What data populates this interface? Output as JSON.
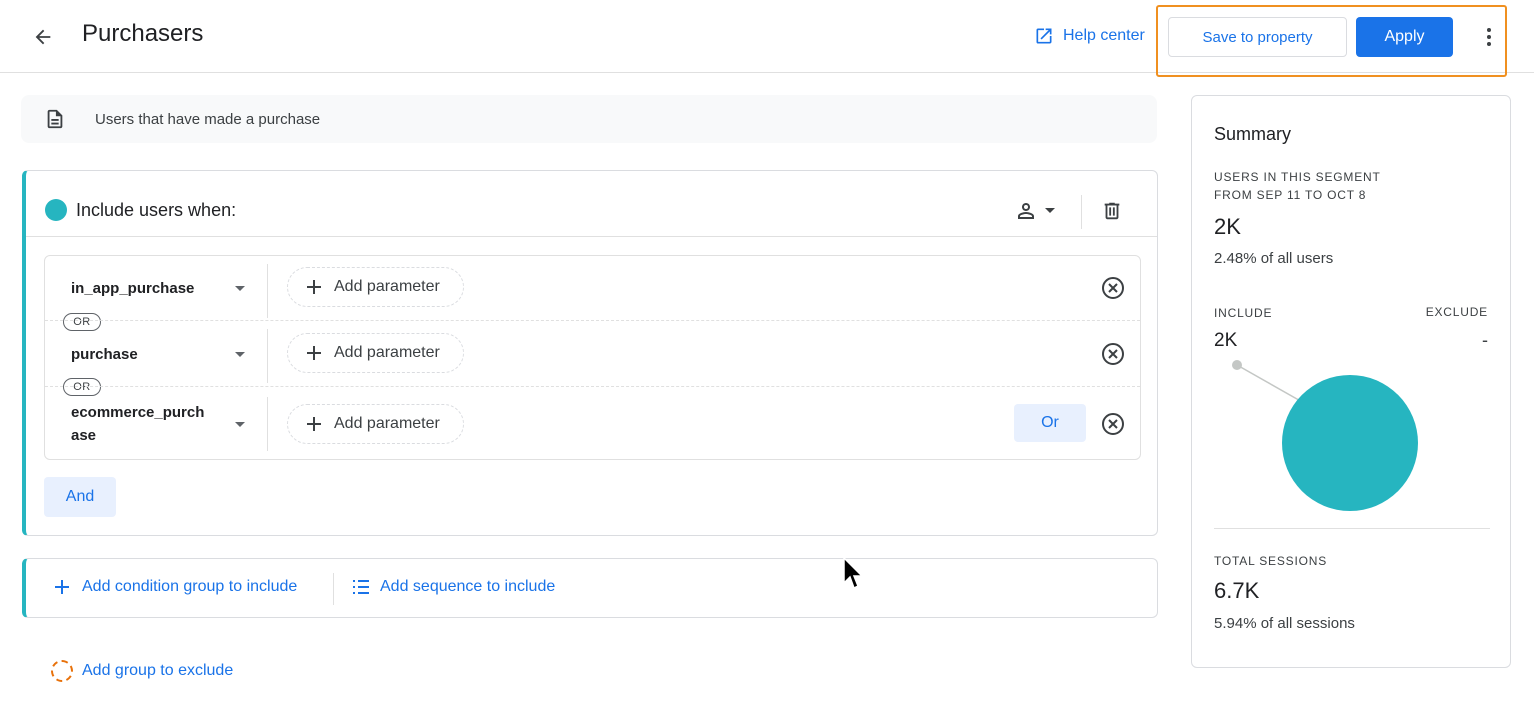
{
  "header": {
    "title": "Purchasers",
    "help_label": "Help center",
    "save_label": "Save to property",
    "apply_label": "Apply"
  },
  "description": "Users that have made a purchase",
  "include_group": {
    "title": "Include users when:",
    "conditions": [
      {
        "event": "in_app_purchase",
        "add_param_label": "Add parameter"
      },
      {
        "event": "purchase",
        "add_param_label": "Add parameter"
      },
      {
        "event": "ecommerce_purchase",
        "event_line1": "ecommerce_purch",
        "event_line2": "ase",
        "add_param_label": "Add parameter"
      }
    ],
    "or_connector": "OR",
    "or_button_label": "Or",
    "and_button_label": "And"
  },
  "add_actions": {
    "condition_group_label": "Add condition group to include",
    "sequence_label": "Add sequence to include",
    "exclude_label": "Add group to exclude"
  },
  "summary": {
    "title": "Summary",
    "segment_label_line1": "USERS IN THIS SEGMENT",
    "segment_label_line2": "FROM SEP 11 TO OCT 8",
    "users_value": "2K",
    "users_pct": "2.48% of all users",
    "include_label": "INCLUDE",
    "exclude_label": "EXCLUDE",
    "include_value": "2K",
    "exclude_value": "-",
    "sessions_label": "TOTAL SESSIONS",
    "sessions_value": "6.7K",
    "sessions_pct": "5.94% of all sessions",
    "pie_color": "#26b5c0"
  },
  "colors": {
    "accent": "#1a73e8",
    "teal": "#26b5c0",
    "highlight": "#f09020"
  }
}
